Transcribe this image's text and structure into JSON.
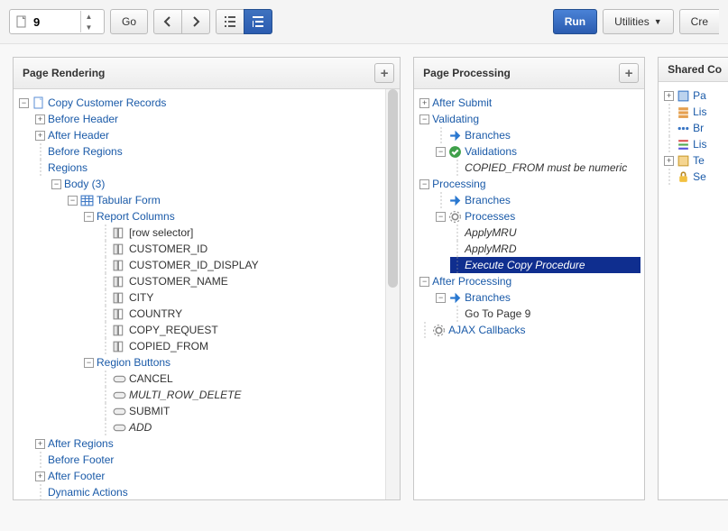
{
  "toolbar": {
    "page_number": "9",
    "go_label": "Go",
    "run_label": "Run",
    "utilities_label": "Utilities",
    "create_label": "Cre"
  },
  "panels": {
    "rendering": {
      "title": "Page Rendering"
    },
    "processing": {
      "title": "Page Processing"
    },
    "shared": {
      "title": "Shared Co"
    }
  },
  "rendering_tree": {
    "root": "Copy Customer Records",
    "before_header": "Before Header",
    "after_header": "After Header",
    "before_regions": "Before Regions",
    "regions": "Regions",
    "body": "Body (3)",
    "tabular_form": "Tabular Form",
    "report_columns": "Report Columns",
    "cols": {
      "row_selector": "[row selector]",
      "customer_id": "CUSTOMER_ID",
      "customer_id_display": "CUSTOMER_ID_DISPLAY",
      "customer_name": "CUSTOMER_NAME",
      "city": "CITY",
      "country": "COUNTRY",
      "copy_request": "COPY_REQUEST",
      "copied_from": "COPIED_FROM"
    },
    "region_buttons": "Region Buttons",
    "btns": {
      "cancel": "CANCEL",
      "multi_row_delete": "MULTI_ROW_DELETE",
      "submit": "SUBMIT",
      "add": "ADD"
    },
    "after_regions": "After Regions",
    "before_footer": "Before Footer",
    "after_footer": "After Footer",
    "dynamic_actions": "Dynamic Actions"
  },
  "processing_tree": {
    "after_submit": "After Submit",
    "validating": "Validating",
    "branches": "Branches",
    "validations": "Validations",
    "copied_from_numeric": "COPIED_FROM must be numeric",
    "processing": "Processing",
    "processes": "Processes",
    "apply_mru": "ApplyMRU",
    "apply_mrd": "ApplyMRD",
    "execute_copy": "Execute Copy Procedure",
    "after_processing": "After Processing",
    "go_to_page_9": "Go To Page 9",
    "ajax_callbacks": "AJAX Callbacks"
  },
  "shared_tree": {
    "pa": "Pa",
    "lis1": "Lis",
    "br": "Br",
    "lis2": "Lis",
    "te": "Te",
    "se": "Se"
  }
}
